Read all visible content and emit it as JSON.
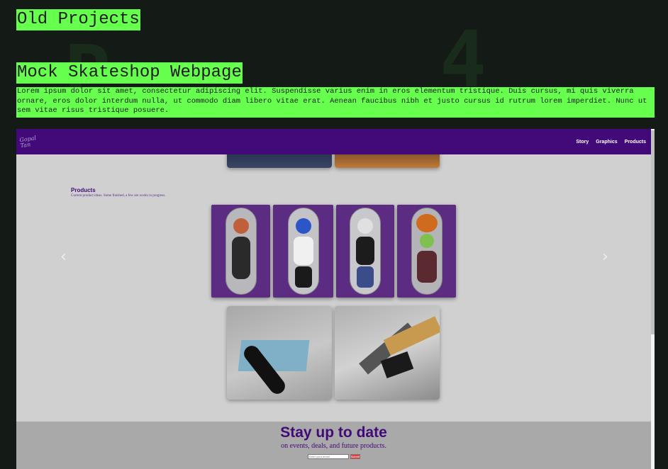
{
  "page": {
    "title": "Old Projects",
    "project": {
      "title": "Mock Skateshop Webpage",
      "description": "Lorem ipsum dolor sit amet, consectetur adipiscing elit. Suspendisse varius enim in eros elementum tristique. Duis cursus, mi quis viverra ornare, eros dolor interdum nulla, ut commodo diam libero vitae erat. Aenean faucibus nibh et justo cursus id rutrum lorem imperdiet. Nunc ut sem vitae risus tristique posuere."
    }
  },
  "mock_site": {
    "logo": "Gopal Tan",
    "nav": [
      "Story",
      "Graphics",
      "Products"
    ],
    "products_heading": "Products",
    "products_sub": "Current product ideas. Some finished, a few are works in progress.",
    "footer_title": "Stay up to date",
    "footer_sub": "on events, deals, and future products.",
    "email_placeholder": "Enter your email",
    "submit_label": "Submit"
  },
  "colors": {
    "highlight": "#66ff4d",
    "nav_purple": "#420a78",
    "background": "#141a15"
  },
  "icons": [
    "chevron-left-icon",
    "chevron-right-icon"
  ]
}
